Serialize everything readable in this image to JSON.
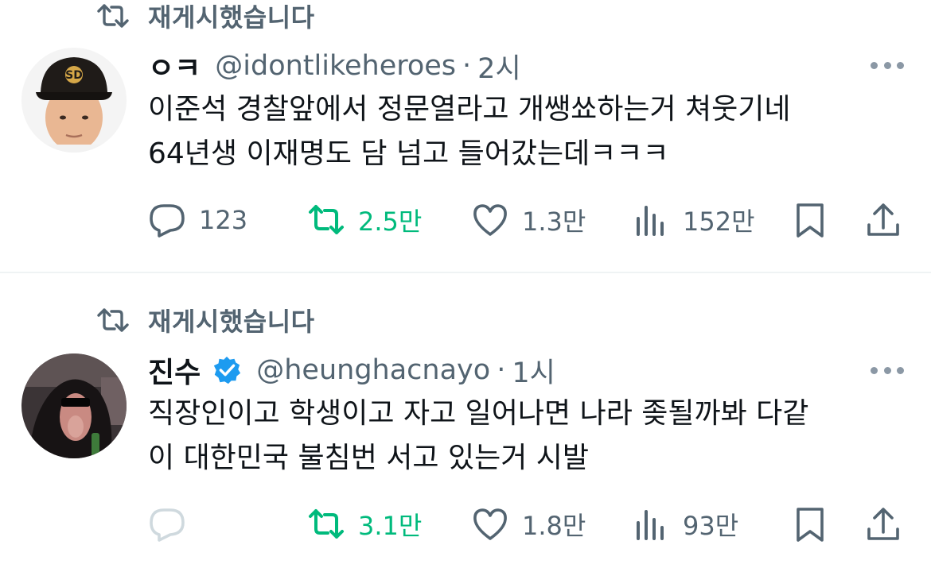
{
  "colors": {
    "text": "#0f1419",
    "secondary": "#536471",
    "retweeted_green": "#00ba7c",
    "verified_blue": "#1d9bf0",
    "divider": "#eff3f4"
  },
  "tweets": [
    {
      "repost_label": "재게시했습니다",
      "display_name": "ㅇㅋ",
      "verified": false,
      "handle": "@idontlikeheroes",
      "separator": "·",
      "time": "2시",
      "text_lines": [
        "이준석 경찰앞에서 정문열라고 개쌩쑈하는거 쳐웃기네",
        "64년생 이재명도 담 넘고 들어갔는데ㅋㅋㅋ"
      ],
      "replies": "123",
      "reposts": "2.5만",
      "likes": "1.3만",
      "views": "152만",
      "icons": [
        "repost-icon",
        "more-icon",
        "reply-icon",
        "repost-icon",
        "like-icon",
        "views-icon",
        "bookmark-icon",
        "share-icon"
      ]
    },
    {
      "repost_label": "재게시했습니다",
      "display_name": "진수",
      "verified": true,
      "handle": "@heunghacnayo",
      "separator": "·",
      "time": "1시",
      "text_lines": [
        "직장인이고 학생이고 자고 일어나면 나라 좆될까봐 다같",
        "이 대한민국 불침번 서고 있는거 시발"
      ],
      "replies": "",
      "reposts": "3.1만",
      "likes": "1.8만",
      "views": "93만",
      "icons": [
        "repost-icon",
        "verified-icon",
        "more-icon",
        "reply-icon",
        "repost-icon",
        "like-icon",
        "views-icon",
        "bookmark-icon",
        "share-icon"
      ]
    }
  ]
}
